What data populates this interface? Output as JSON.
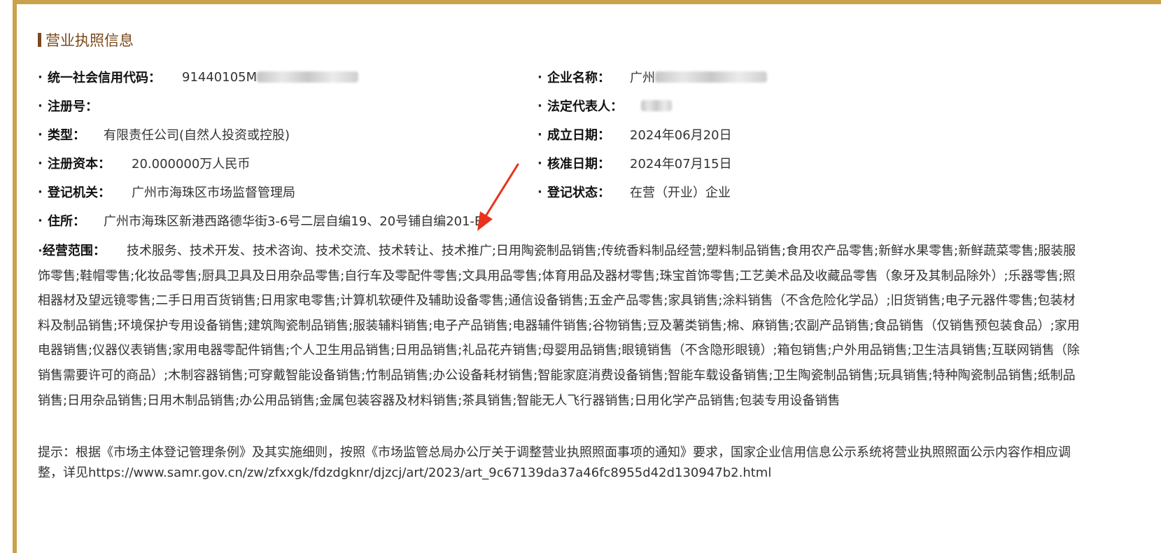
{
  "section": {
    "title": "营业执照信息"
  },
  "fields": {
    "credit_code": {
      "label": "统一社会信用代码：",
      "value": "91440105M"
    },
    "company_name": {
      "label": "企业名称：",
      "value": "广州"
    },
    "reg_no": {
      "label": "注册号：",
      "value": ""
    },
    "legal_rep": {
      "label": "法定代表人：",
      "value": ""
    },
    "type": {
      "label": "类型：",
      "value": "有限责任公司(自然人投资或控股)"
    },
    "est_date": {
      "label": "成立日期：",
      "value": "2024年06月20日"
    },
    "capital": {
      "label": "注册资本：",
      "value": "20.000000万人民币"
    },
    "approve_date": {
      "label": "核准日期：",
      "value": "2024年07月15日"
    },
    "authority": {
      "label": "登记机关：",
      "value": "广州市海珠区市场监督管理局"
    },
    "status": {
      "label": "登记状态：",
      "value": "在营（开业）企业"
    },
    "address": {
      "label": "住所：",
      "value": "广州市海珠区新港西路德华街3-6号二层自编19、20号铺自编201-B"
    }
  },
  "scope": {
    "label": "经营范围：",
    "value": "技术服务、技术开发、技术咨询、技术交流、技术转让、技术推广;日用陶瓷制品销售;传统香料制品经营;塑料制品销售;食用农产品零售;新鲜水果零售;新鲜蔬菜零售;服装服饰零售;鞋帽零售;化妆品零售;厨具卫具及日用杂品零售;自行车及零配件零售;文具用品零售;体育用品及器材零售;珠宝首饰零售;工艺美术品及收藏品零售（象牙及其制品除外）;乐器零售;照相器材及望远镜零售;二手日用百货销售;日用家电零售;计算机软硬件及辅助设备零售;通信设备销售;五金产品零售;家具销售;涂料销售（不含危险化学品）;旧货销售;电子元器件零售;包装材料及制品销售;环境保护专用设备销售;建筑陶瓷制品销售;服装辅料销售;电子产品销售;电器辅件销售;谷物销售;豆及薯类销售;棉、麻销售;农副产品销售;食品销售（仅销售预包装食品）;家用电器销售;仪器仪表销售;家用电器零配件销售;个人卫生用品销售;日用品销售;礼品花卉销售;母婴用品销售;眼镜销售（不含隐形眼镜）;箱包销售;户外用品销售;卫生洁具销售;互联网销售（除销售需要许可的商品）;木制容器销售;可穿戴智能设备销售;竹制品销售;办公设备耗材销售;智能家庭消费设备销售;智能车载设备销售;卫生陶瓷制品销售;玩具销售;特种陶瓷制品销售;纸制品销售;日用杂品销售;日用木制品销售;办公用品销售;金属包装容器及材料销售;茶具销售;智能无人飞行器销售;日用化学产品销售;包装专用设备销售"
  },
  "notice": {
    "text": "提示：根据《市场主体登记管理条例》及其实施细则，按照《市场监管总局办公厅关于调整营业执照照面事项的通知》要求，国家企业信用信息公示系统将营业执照照面公示内容作相应调整，详见https://www.samr.gov.cn/zw/zfxxgk/fdzdgknr/djzcj/art/2023/art_9c67139da37a46fc8955d42d130947b2.html"
  },
  "colors": {
    "border": "#c9a24b",
    "title": "#7a4a1c",
    "arrow": "#e8321c"
  }
}
